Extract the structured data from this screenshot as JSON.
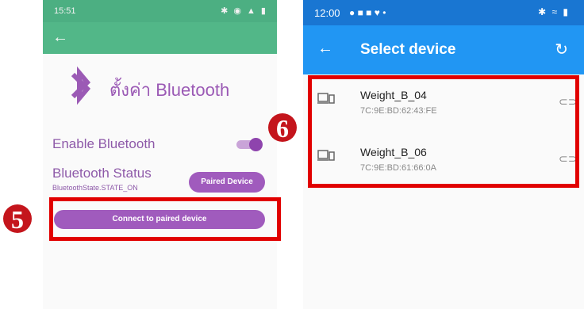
{
  "left_screen": {
    "status_time": "15:51",
    "status_icons": "✱ ◉ ▲ ▮",
    "back_icon": "arrow-left-icon",
    "title": "ตั้งค่า Bluetooth",
    "enable_label": "Enable Bluetooth",
    "toggle_on": true,
    "status_label": "Bluetooth Status",
    "status_value": "BluetoothState.STATE_ON",
    "paired_button": "Paired Device",
    "connect_button": "Connect to paired device",
    "accent": "#a05bbd"
  },
  "right_screen": {
    "status_time": "12:00",
    "status_icons": "✱ ≈ ▮",
    "title": "Select device",
    "devices": [
      {
        "name": "Weight_B_04",
        "mac": "7C:9E:BD:62:43:FE"
      },
      {
        "name": "Weight_B_06",
        "mac": "7C:9E:BD:61:66:0A"
      }
    ],
    "accent": "#2196f3"
  },
  "annotations": {
    "badge_5": "5",
    "badge_6": "6",
    "box_color": "#e10000"
  }
}
